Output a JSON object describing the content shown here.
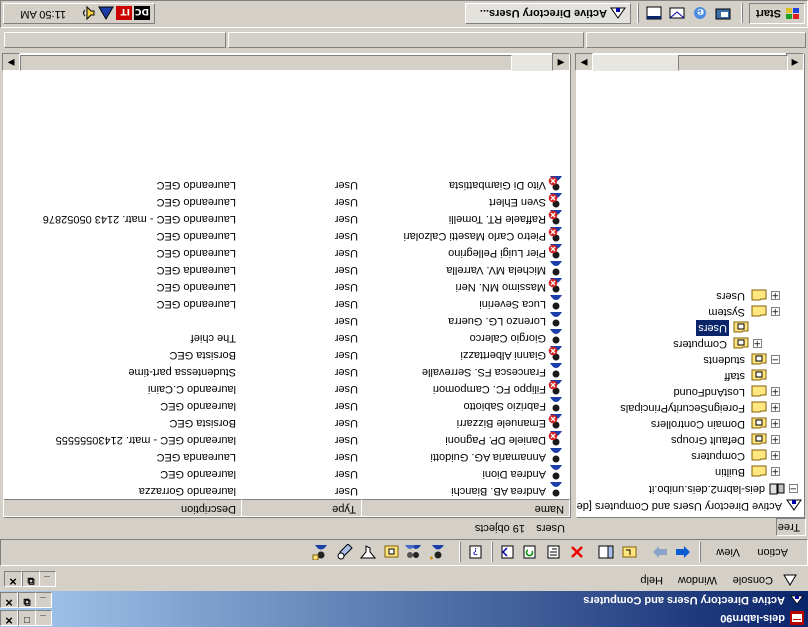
{
  "app_window": {
    "title": "deis-labrn90",
    "buttons": [
      "_",
      "□",
      "✕"
    ]
  },
  "mmc_window": {
    "title": "Active Directory Users and Computers",
    "buttons": [
      "_",
      "⧉",
      "✕"
    ]
  },
  "menu": {
    "console": "Console",
    "window": "Window",
    "help": "Help"
  },
  "toolbar": {
    "action": "Action",
    "view": "View"
  },
  "tabs": {
    "tree": "Tree"
  },
  "right_header": {
    "container": "Users",
    "count": "19 objects"
  },
  "columns": {
    "name": "Name",
    "type": "Type",
    "description": "Description"
  },
  "tree": {
    "root": "Active Directory Users and Computers [dei",
    "domain": "deis-labrn2.deis.unibo.it",
    "items": [
      {
        "label": "Builtin",
        "level": 2,
        "expander": "+",
        "icon": "folder"
      },
      {
        "label": "Computers",
        "level": 2,
        "expander": "+",
        "icon": "folder"
      },
      {
        "label": "Default Groups",
        "level": 2,
        "expander": "+",
        "icon": "ou"
      },
      {
        "label": "Domain Controllers",
        "level": 2,
        "expander": "+",
        "icon": "ou"
      },
      {
        "label": "ForeignSecurityPrincipals",
        "level": 2,
        "expander": "+",
        "icon": "folder"
      },
      {
        "label": "LostAndFound",
        "level": 2,
        "expander": "+",
        "icon": "folder"
      },
      {
        "label": "staff",
        "level": 2,
        "expander": "",
        "icon": "ou"
      },
      {
        "label": "students",
        "level": 2,
        "expander": "−",
        "icon": "ou"
      },
      {
        "label": "Computers",
        "level": 3,
        "expander": "+",
        "icon": "ou"
      },
      {
        "label": "Users",
        "level": 3,
        "expander": "",
        "icon": "ou",
        "selected": true
      },
      {
        "label": "System",
        "level": 2,
        "expander": "+",
        "icon": "folder"
      },
      {
        "label": "Users",
        "level": 2,
        "expander": "+",
        "icon": "folder"
      }
    ]
  },
  "users": [
    {
      "name": "Andrea AB. Bianchi",
      "type": "User",
      "description": "laureando Gorrazza",
      "disabled": false
    },
    {
      "name": "Andrea Dioni",
      "type": "User",
      "description": "laureando GEC",
      "disabled": false
    },
    {
      "name": "Annamaria AG. Guidotti",
      "type": "User",
      "description": "Laureanda GEC",
      "disabled": false
    },
    {
      "name": "Daniele DP. Pagnoni",
      "type": "User",
      "description": "laureando GEC - matr. 21430555555",
      "disabled": true
    },
    {
      "name": "Emanuele Bizzarri",
      "type": "User",
      "description": "Borsista GEC",
      "disabled": true
    },
    {
      "name": "Fabrizio Sabiotto",
      "type": "User",
      "description": "laureando GEC",
      "disabled": false
    },
    {
      "name": "Filippo FC. Campomori",
      "type": "User",
      "description": "laureando C.Caini",
      "disabled": true
    },
    {
      "name": "Francesca FS. Serrevalle",
      "type": "User",
      "description": "Studentessa part-time",
      "disabled": false
    },
    {
      "name": "Gianni Alberttazzi",
      "type": "User",
      "description": "Borsista GEC",
      "disabled": true
    },
    {
      "name": "Giorgio Calerco",
      "type": "User",
      "description": "The chief",
      "disabled": false
    },
    {
      "name": "Lorenzo LG. Guerra",
      "type": "User",
      "description": "",
      "disabled": false
    },
    {
      "name": "Luca Severini",
      "type": "User",
      "description": "Laureando GEC",
      "disabled": false
    },
    {
      "name": "Massimo MN. Neri",
      "type": "User",
      "description": "Laureando GEC",
      "disabled": true
    },
    {
      "name": "Michela MV. Varrella",
      "type": "User",
      "description": "Laureanda GEC",
      "disabled": false
    },
    {
      "name": "Pier Luigi Pellegrino",
      "type": "User",
      "description": "Laureando GEC",
      "disabled": true
    },
    {
      "name": "Pietro Carlo Masetti Calzolari",
      "type": "User",
      "description": "Laureando GEC",
      "disabled": true
    },
    {
      "name": "Raffaele RT. Tomelli",
      "type": "User",
      "description": "Laureando GEC - matr. 2143 05052876",
      "disabled": true
    },
    {
      "name": "Sven Ehlert",
      "type": "User",
      "description": "Laureando GEC",
      "disabled": true
    },
    {
      "name": "Vito Di Giambattista",
      "type": "User",
      "description": "Laureando GEC",
      "disabled": true
    }
  ],
  "taskbar": {
    "start": "Start",
    "task": "Active Directory Users...",
    "clock": "11:50 AM"
  },
  "colors": {
    "title_active": "#0a246a",
    "face": "#d4d0c8",
    "selection": "#0a246a",
    "disabled_badge": "#d42020"
  }
}
